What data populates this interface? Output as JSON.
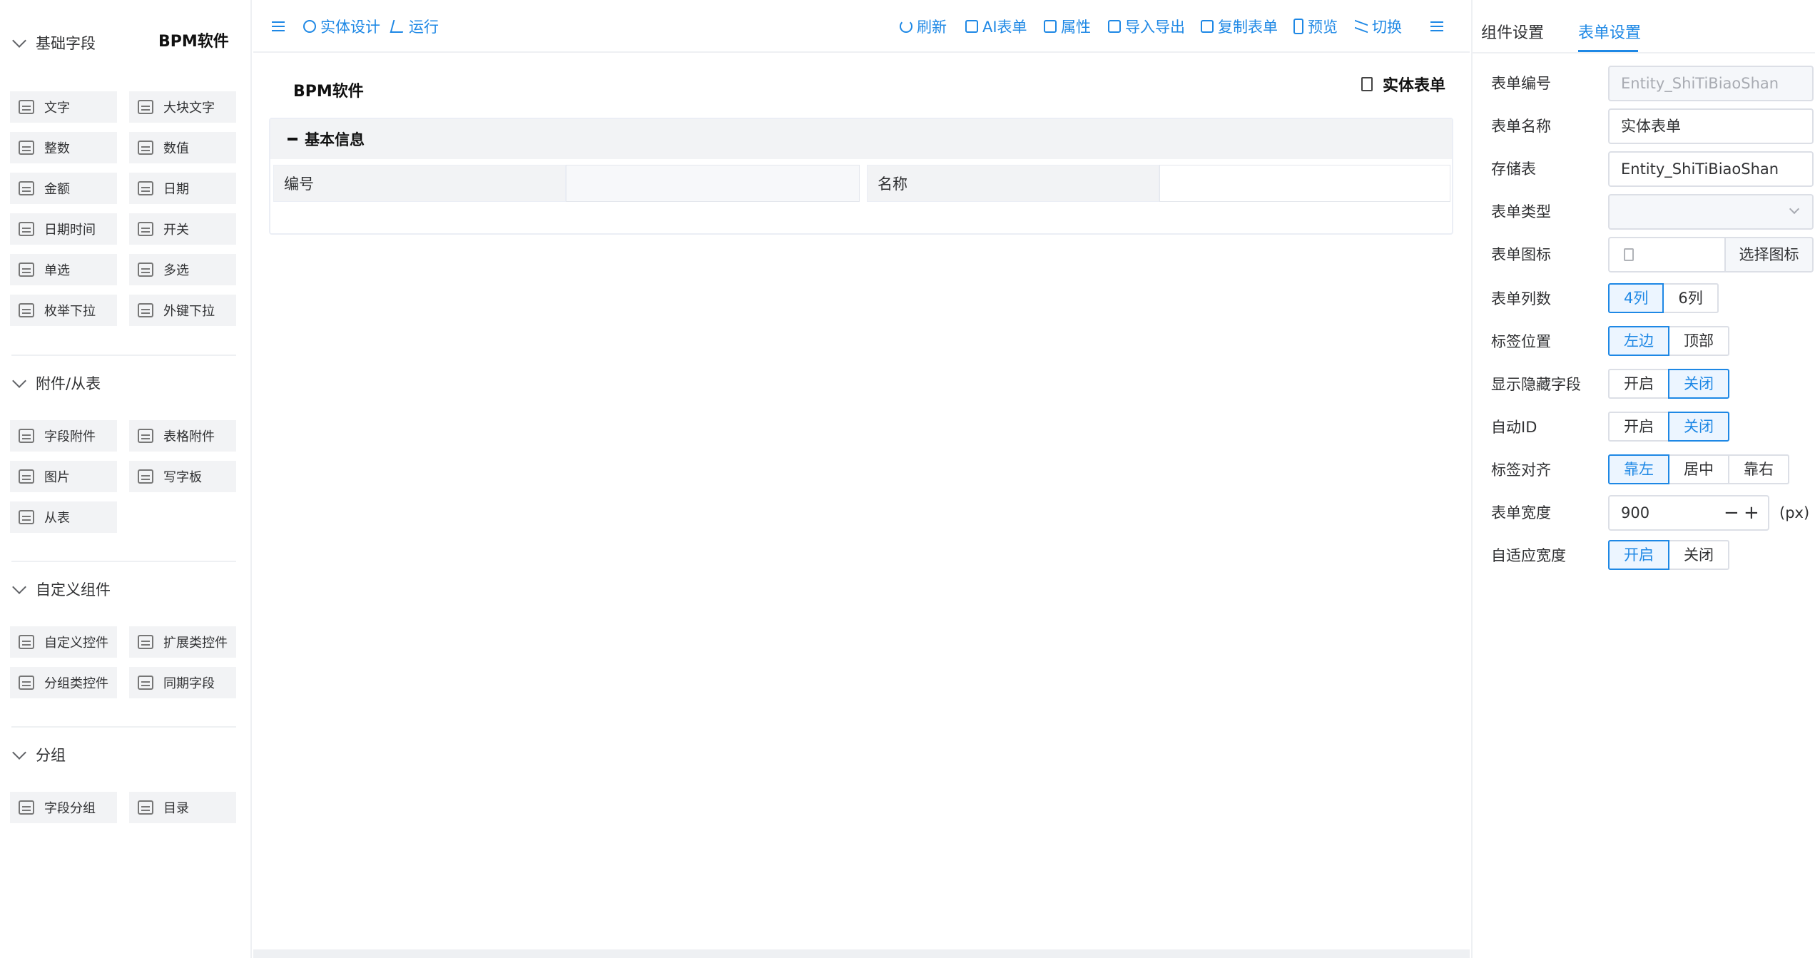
{
  "left": {
    "brand": "BPM软件",
    "sections": [
      {
        "title": "基础字段",
        "items": [
          "文字",
          "大块文字",
          "整数",
          "数值",
          "金额",
          "日期",
          "日期时间",
          "开关",
          "单选",
          "多选",
          "枚举下拉",
          "外键下拉"
        ]
      },
      {
        "title": "附件/从表",
        "items": [
          "字段附件",
          "表格附件",
          "图片",
          "写字板",
          "从表"
        ]
      },
      {
        "title": "自定义组件",
        "items": [
          "自定义控件",
          "扩展类控件",
          "分组类控件",
          "同期字段"
        ]
      },
      {
        "title": "分组",
        "items": [
          "字段分组",
          "目录"
        ]
      }
    ]
  },
  "toolbar": {
    "entity_design": "实体设计",
    "run": "运行",
    "refresh": "刷新",
    "ai_form": "AI表单",
    "properties": "属性",
    "import_export": "导入导出",
    "copy_form": "复制表单",
    "preview": "预览",
    "switch": "切换"
  },
  "canvas": {
    "title": "BPM软件",
    "form_name": "实体表单",
    "group_title": "基本信息",
    "fields": [
      {
        "label": "编号",
        "value": ""
      },
      {
        "label": "名称",
        "value": ""
      }
    ]
  },
  "right": {
    "tabs": [
      "组件设置",
      "表单设置"
    ],
    "active_tab": "表单设置",
    "props": {
      "form_code_label": "表单编号",
      "form_code_value": "Entity_ShiTiBiaoShan",
      "form_name_label": "表单名称",
      "form_name_value": "实体表单",
      "storage_label": "存储表",
      "storage_value": "Entity_ShiTiBiaoShan",
      "form_type_label": "表单类型",
      "form_type_value": "",
      "form_icon_label": "表单图标",
      "select_icon": "选择图标",
      "columns_label": "表单列数",
      "columns_opts": [
        "4列",
        "6列"
      ],
      "label_pos_label": "标签位置",
      "label_pos_opts": [
        "左边",
        "顶部"
      ],
      "show_hidden_label": "显示隐藏字段",
      "on": "开启",
      "off": "关闭",
      "auto_id_label": "自动ID",
      "label_align_label": "标签对齐",
      "label_align_opts": [
        "靠左",
        "居中",
        "靠右"
      ],
      "width_label": "表单宽度",
      "width_value": "900",
      "width_unit": "(px)",
      "adaptive_label": "自适应宽度"
    }
  },
  "colors": {
    "accent": "#1e88e5",
    "panel_bg": "#f2f3f5",
    "border": "#dcdfe6"
  }
}
